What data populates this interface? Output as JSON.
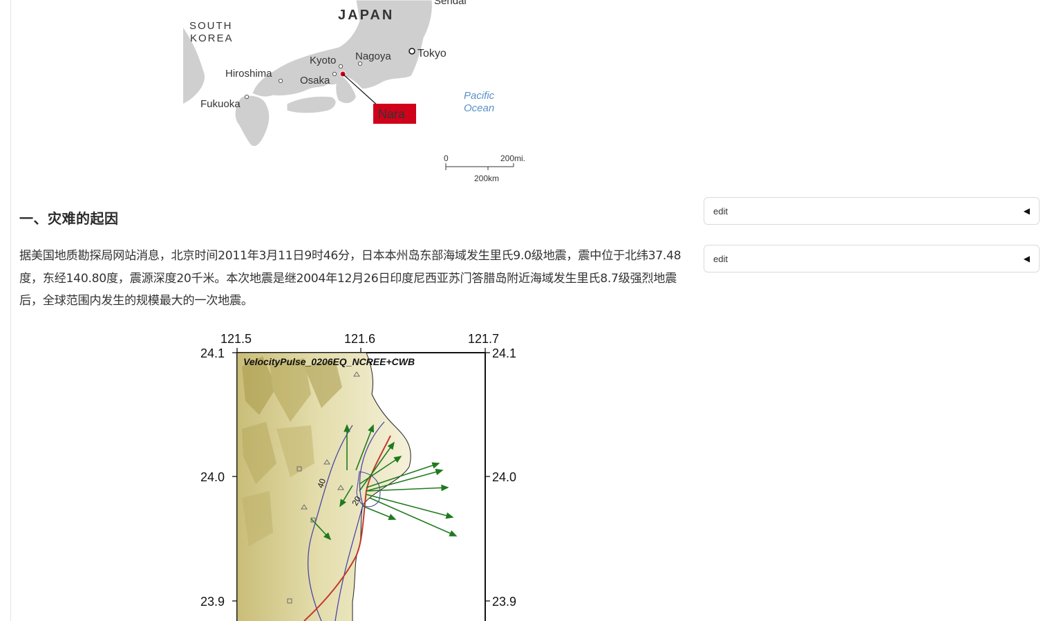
{
  "japan_map": {
    "country_label": "JAPAN",
    "neighbor_label_line1": "SOUTH",
    "neighbor_label_line2": "KOREA",
    "cities": [
      "Sendai",
      "Tokyo",
      "Nagoya",
      "Kyoto",
      "Osaka",
      "Hiroshima",
      "Fukuoka"
    ],
    "highlight_city": "Nara",
    "ocean_line1": "Pacific",
    "ocean_line2": "Ocean",
    "scale_zero": "0",
    "scale_miles": "200mi.",
    "scale_km": "200km",
    "colors": {
      "land": "#cfcfcf",
      "highlight": "#d0021b",
      "ocean_text": "#5b8fc7"
    }
  },
  "section": {
    "heading": "一、灾难的起因",
    "paragraph": "据美国地质勘探局网站消息，北京时间2011年3月11日9时46分，日本本州岛东部海域发生里氏9.0级地震，震中位于北纬37.48度，东经140.80度，震源深度20千米。本次地震是继2004年12月26日印度尼西亚苏门答腊岛附近海域发生里氏8.7级强烈地震后，全球范围内发生的规模最大的一次地震。"
  },
  "sidebar": {
    "edit_items": [
      {
        "label": "edit",
        "toggle_icon": "triangle-left-icon"
      },
      {
        "label": "edit",
        "toggle_icon": "triangle-left-icon"
      }
    ]
  },
  "quake_map": {
    "title": "VelocityPulse_0206EQ_NCREE+CWB",
    "x_ticks": [
      "121.5",
      "121.6",
      "121.7"
    ],
    "y_ticks": [
      "24.1",
      "24.0",
      "23.9"
    ],
    "contour_labels": [
      "40",
      "20"
    ],
    "colors": {
      "arrows": "#1e7a1e",
      "fault": "#c0392b",
      "contour": "#4a46a8"
    }
  }
}
